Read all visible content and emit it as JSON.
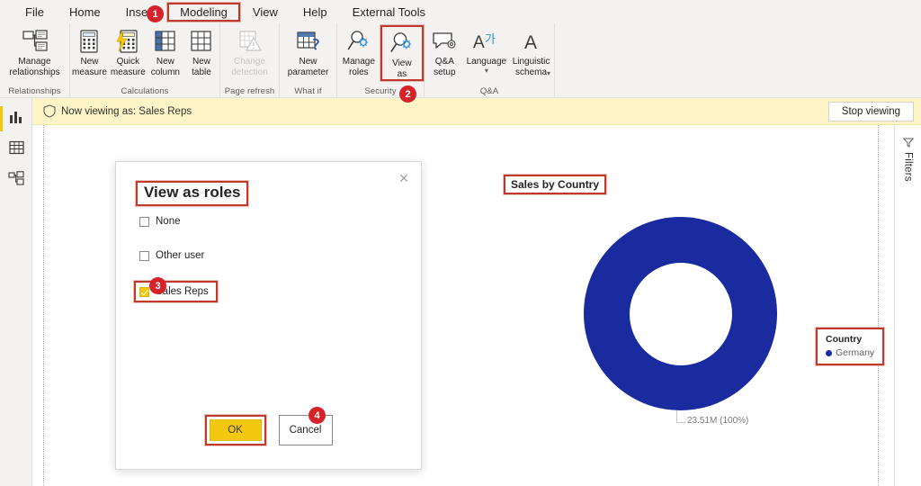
{
  "ribbon": {
    "tabs": [
      {
        "label": "File",
        "active": false
      },
      {
        "label": "Home",
        "active": false
      },
      {
        "label": "Insert",
        "active": false
      },
      {
        "label": "Modeling",
        "active": true
      },
      {
        "label": "View",
        "active": false
      },
      {
        "label": "Help",
        "active": false
      },
      {
        "label": "External Tools",
        "active": false
      }
    ],
    "groups": [
      {
        "name": "Relationships",
        "label": "Relationships",
        "buttons": [
          {
            "caption": "Manage\nrelationships",
            "icon": "manage-relationships-icon",
            "disabled": false
          }
        ]
      },
      {
        "name": "Calculations",
        "label": "Calculations",
        "buttons": [
          {
            "caption": "New\nmeasure",
            "icon": "new-measure-icon",
            "disabled": false
          },
          {
            "caption": "Quick\nmeasure",
            "icon": "quick-measure-icon",
            "disabled": false
          },
          {
            "caption": "New\ncolumn",
            "icon": "new-column-icon",
            "disabled": false
          },
          {
            "caption": "New\ntable",
            "icon": "new-table-icon",
            "disabled": false
          }
        ]
      },
      {
        "name": "PageRefresh",
        "label": "Page refresh",
        "buttons": [
          {
            "caption": "Change\ndetection",
            "icon": "change-detection-icon",
            "disabled": true
          }
        ]
      },
      {
        "name": "WhatIf",
        "label": "What if",
        "buttons": [
          {
            "caption": "New\nparameter",
            "icon": "new-parameter-icon",
            "disabled": false
          }
        ]
      },
      {
        "name": "Security",
        "label": "Security",
        "buttons": [
          {
            "caption": "Manage\nroles",
            "icon": "manage-roles-icon",
            "disabled": false
          },
          {
            "caption": "View\nas",
            "icon": "view-as-icon",
            "disabled": false,
            "highlighted": true
          }
        ]
      },
      {
        "name": "QandA",
        "label": "Q&A",
        "buttons": [
          {
            "caption": "Q&A\nsetup",
            "icon": "qa-setup-icon",
            "disabled": false
          },
          {
            "caption": "Language",
            "icon": "language-icon",
            "disabled": false,
            "dropdown": true
          },
          {
            "caption": "Linguistic\nschema",
            "icon": "linguistic-schema-icon",
            "disabled": false,
            "dropdown": true
          }
        ]
      }
    ]
  },
  "left_rail": {
    "items": [
      {
        "name": "report-view",
        "icon": "report-view-icon",
        "selected": true
      },
      {
        "name": "data-view",
        "icon": "data-view-icon",
        "selected": false
      },
      {
        "name": "model-view",
        "icon": "model-view-icon",
        "selected": false
      }
    ]
  },
  "notification": {
    "icon": "shield-icon",
    "text": "Now viewing as: Sales Reps",
    "stop_label": "Stop viewing",
    "background": "#fdf5c8"
  },
  "filters_pane": {
    "label": "Filters",
    "icon": "filter-icon"
  },
  "dialog": {
    "title": "View as roles",
    "close_icon": "close-icon",
    "options": [
      {
        "label": "None",
        "checked": false,
        "highlighted": false
      },
      {
        "label": "Other user",
        "checked": false,
        "highlighted": false
      },
      {
        "label": "Sales Reps",
        "checked": true,
        "highlighted": true
      }
    ],
    "ok_label": "OK",
    "cancel_label": "Cancel"
  },
  "visual": {
    "title": "Sales by Country",
    "data_label": "23.51M (100%)",
    "legend": {
      "title": "Country",
      "items": [
        {
          "label": "Germany",
          "color": "#1a2ba0"
        }
      ]
    }
  },
  "chart_data": {
    "type": "pie",
    "title": "Sales by Country",
    "subtype": "donut",
    "categories": [
      "Germany"
    ],
    "values": [
      23510000
    ],
    "value_labels": [
      "23.51M (100%)"
    ],
    "percentages": [
      100
    ],
    "colors": [
      "#1a2ba0"
    ],
    "legend_title": "Country",
    "legend_position": "right",
    "grid": false
  },
  "annotations": {
    "badges": [
      {
        "number": "1",
        "target": "modeling-tab"
      },
      {
        "number": "2",
        "target": "view-as-button"
      },
      {
        "number": "3",
        "target": "sales-reps-checkbox"
      },
      {
        "number": "4",
        "target": "ok-button"
      }
    ],
    "highlight_color": "#c0392b"
  },
  "theme": {
    "accent": "#f2c811",
    "ribbon_bg": "#f3f2f1",
    "donut_blue": "#1a2ba0",
    "badge_red": "#d6232a"
  }
}
